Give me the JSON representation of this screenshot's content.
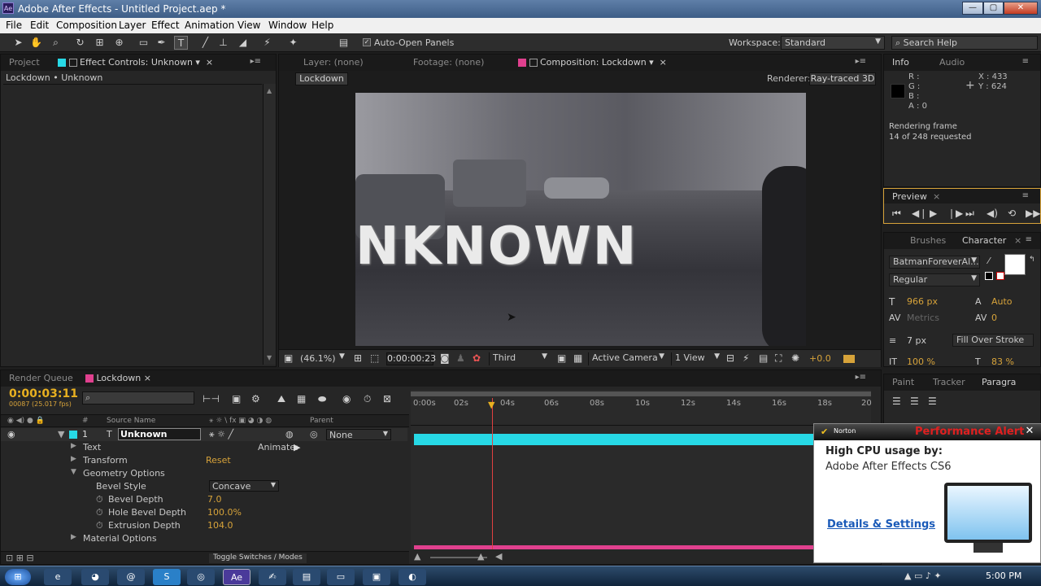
{
  "window": {
    "title": "Adobe After Effects - Untitled Project.aep *",
    "app_badge": "Ae",
    "min_btn": "—",
    "max_btn": "▢",
    "close_btn": "✕"
  },
  "menu": [
    "File",
    "Edit",
    "Composition",
    "Layer",
    "Effect",
    "Animation",
    "View",
    "Window",
    "Help"
  ],
  "toolbar": {
    "auto_open_label": "Auto-Open Panels",
    "workspace_label": "Workspace:",
    "workspace_value": "Standard",
    "search_placeholder": "Search Help"
  },
  "left_panel": {
    "tab_project": "Project",
    "tab_effect": "Effect Controls: Unknown",
    "breadcrumb": "Lockdown • Unknown"
  },
  "comp_panel": {
    "tab_layer": "Layer: (none)",
    "tab_footage": "Footage: (none)",
    "tab_comp": "Composition: Lockdown",
    "comp_button": "Lockdown",
    "renderer_label": "Renderer:",
    "renderer_value": "Ray-traced 3D",
    "viewer_text": "NKNOWN"
  },
  "viewer_bar": {
    "zoom": "(46.1%)",
    "timecode": "0:00:00:23",
    "resolution": "Third",
    "camera": "Active Camera",
    "views": "1 View",
    "exposure": "+0.0"
  },
  "info_panel": {
    "tab_info": "Info",
    "tab_audio": "Audio",
    "r": "R :",
    "g": "G :",
    "b": "B :",
    "a": "A : 0",
    "x": "X : 433",
    "y": "Y : 624",
    "status_line1": "Rendering frame",
    "status_line2": "14 of 248 requested"
  },
  "preview_panel": {
    "tab": "Preview"
  },
  "character_panel": {
    "tab_brushes": "Brushes",
    "tab_character": "Character",
    "font": "BatmanForeverAl...",
    "style": "Regular",
    "size": "966 px",
    "leading": "Auto",
    "kerning": "Metrics",
    "tracking": "0",
    "stroke_width": "7 px",
    "stroke_type": "Fill Over Stroke",
    "vscale": "100 %",
    "hscale": "83 %"
  },
  "paragraph_panel": {
    "tab_paint": "Paint",
    "tab_tracker": "Tracker",
    "tab_paragraph": "Paragra"
  },
  "timeline": {
    "tab_render": "Render Queue",
    "tab_comp": "Lockdown",
    "timecode": "0:00:03:11",
    "fps_line": "00087 (25.017 fps)",
    "col_num": "#",
    "col_source": "Source Name",
    "col_parent": "Parent",
    "layer_num": "1",
    "layer_name": "Unknown",
    "layer_parent": "None",
    "ruler": [
      "0:00s",
      "02s",
      "04s",
      "06s",
      "08s",
      "10s",
      "12s",
      "14s",
      "16s",
      "18s",
      "20"
    ],
    "toggle_label": "Toggle Switches / Modes"
  },
  "properties": [
    {
      "label": "Text",
      "value": "",
      "extra": "Animate:"
    },
    {
      "label": "Transform",
      "value": "Reset",
      "extra": ""
    },
    {
      "label": "Geometry Options",
      "value": "",
      "extra": ""
    },
    {
      "label": "Bevel Style",
      "value": "Concave",
      "extra": ""
    },
    {
      "label": "Bevel Depth",
      "value": "7.0",
      "extra": ""
    },
    {
      "label": "Hole Bevel Depth",
      "value": "100.0%",
      "extra": ""
    },
    {
      "label": "Extrusion Depth",
      "value": "104.0",
      "extra": ""
    },
    {
      "label": "Material Options",
      "value": "",
      "extra": ""
    }
  ],
  "norton": {
    "brand": "Norton",
    "title": "Performance Alert",
    "heading": "High CPU usage by:",
    "app": "Adobe After Effects CS6",
    "link": "Details & Settings"
  },
  "taskbar": {
    "clock": "5:00 PM"
  },
  "colors": {
    "accent_cyan": "#27d9e6",
    "accent_pink": "#e0408e",
    "timecode_yellow": "#e8b020",
    "norton_red": "#e02020"
  }
}
